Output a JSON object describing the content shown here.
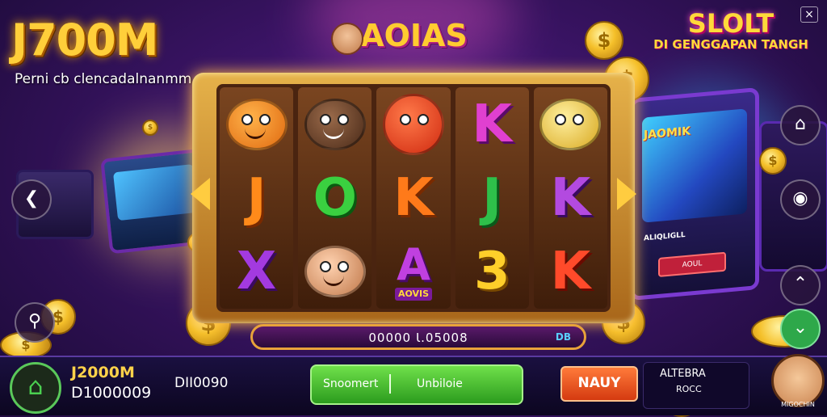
{
  "header": {
    "logo": "J700M",
    "tagline": "Perni cb clencadalnanmm",
    "game_title": "AOIAS",
    "brand_line1": "SLOLT",
    "brand_line2": "DI GENGGAPAN TANGH",
    "close_icon": "×"
  },
  "reels": [
    [
      "orange-fruit",
      "J",
      "X"
    ],
    [
      "brown-fruit",
      "O",
      "face"
    ],
    [
      "red-ball",
      "K",
      "A"
    ],
    [
      "K",
      "J",
      "3"
    ],
    [
      "lemon-fruit",
      "K",
      "K"
    ]
  ],
  "reel_symbol_colors": {
    "J_orange": "#ff8a1a",
    "O_green": "#3ad040",
    "K_orange": "#ff7a1a",
    "J_green": "#2ec04a",
    "K_purple": "#b34ae0",
    "X_purple": "#a33ae0",
    "A_purple": "#c040e0",
    "3_gold": "#ffcf2a",
    "K_red": "#ff4a2a",
    "K_pink": "#e040d0"
  },
  "symbol_labels": {
    "A_caption": "AOVIS"
  },
  "balance_bar": {
    "value": "00000 Ɩ.05008",
    "currency": "DB"
  },
  "right_machine": {
    "screen_title": "JAOMIK",
    "label": "ALIQLIGLL",
    "button": "AOUL"
  },
  "bottom": {
    "player_name": "J2000M",
    "player_balance": "D1000009",
    "secondary_balance": "DII0090",
    "spin_left": "Snoomert",
    "spin_right": "Unbiloie",
    "menu_label": "NAUY",
    "alt_line1": "ALTEBRA",
    "alt_line2": "ROCC",
    "mascot_label": "MIGOCHIN"
  },
  "side_buttons_left": [
    "chevron-left-icon",
    "search-icon"
  ],
  "side_buttons_right": [
    "home-icon",
    "record-icon",
    "chevron-up-icon",
    "chevron-down-icon"
  ],
  "colors": {
    "accent_gold": "#ffcf3a",
    "frame_gold": "#e6b24a",
    "spin_green": "#2c9c1e",
    "menu_orange": "#ff7a3a"
  }
}
